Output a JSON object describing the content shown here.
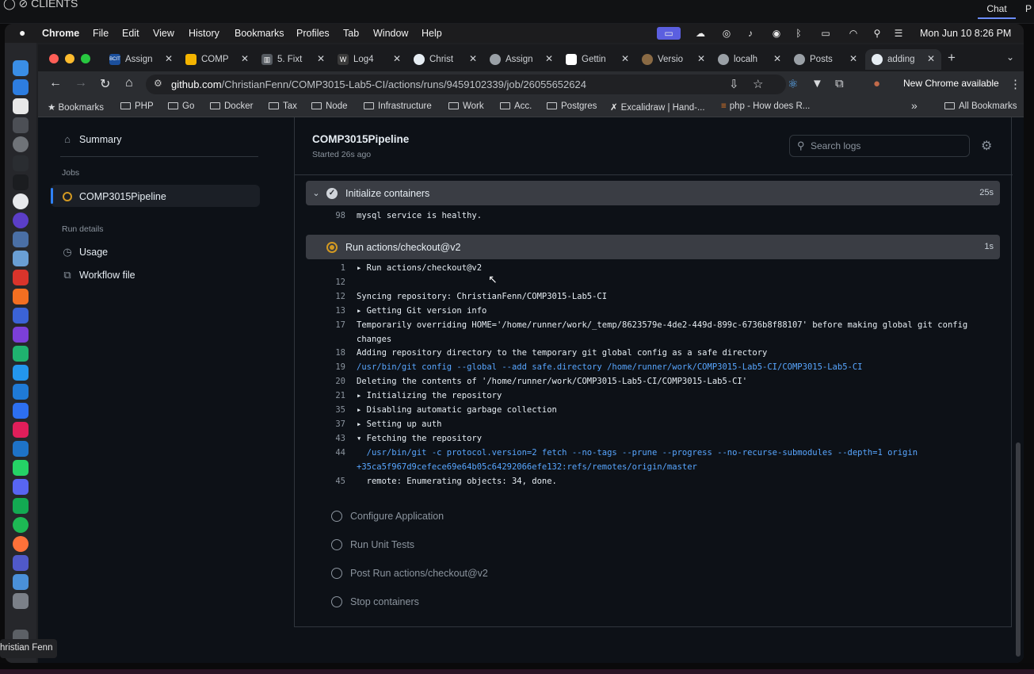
{
  "outer": {
    "top_glyphs": "◯   ⊘   CLIENTS",
    "chat_label": "Chat",
    "extra_label": "P"
  },
  "menubar": {
    "apple": "",
    "items": [
      "Chrome",
      "File",
      "Edit",
      "View",
      "History",
      "Bookmarks",
      "Profiles",
      "Tab",
      "Window",
      "Help"
    ],
    "clock": "Mon Jun 10  8:26 PM"
  },
  "tabs": [
    {
      "title": "Assign",
      "fav": "BCIT",
      "fav_color": "#1b4f9c"
    },
    {
      "title": "COMP",
      "fav": "",
      "fav_color": "#f4b400"
    },
    {
      "title": "5. Fixt",
      "fav": "▥",
      "fav_color": "#555a60"
    },
    {
      "title": "Log4",
      "fav": "W",
      "fav_color": "#3a3a3a"
    },
    {
      "title": "Christ",
      "fav": "",
      "fav_color": "#e6edf3"
    },
    {
      "title": "Assign",
      "fav": "",
      "fav_color": "#9aa0a6"
    },
    {
      "title": "Gettin",
      "fav": "",
      "fav_color": "#ffffff"
    },
    {
      "title": "Versio",
      "fav": "",
      "fav_color": "#8a6a44"
    },
    {
      "title": "localh",
      "fav": "",
      "fav_color": "#9aa0a6"
    },
    {
      "title": "Posts",
      "fav": "",
      "fav_color": "#9aa0a6"
    },
    {
      "title": "adding",
      "fav": "",
      "fav_color": "#e6edf3"
    }
  ],
  "address": {
    "host": "github.com",
    "path": "/ChristianFenn/COMP3015-Lab5-CI/actions/runs/9459102339/job/26055652624"
  },
  "toolbar": {
    "new_chrome": "New Chrome available"
  },
  "bookmarks": {
    "first": "Bookmarks",
    "items": [
      "PHP",
      "Go",
      "Docker",
      "Tax",
      "Node",
      "Infrastructure",
      "Work",
      "Acc.",
      "Postgres",
      "Excalidraw | Hand-...",
      "php - How does R..."
    ],
    "overflow": "»",
    "all": "All Bookmarks"
  },
  "sidebar": {
    "summary": "Summary",
    "jobs_heading": "Jobs",
    "job": "COMP3015Pipeline",
    "run_details_heading": "Run details",
    "usage": "Usage",
    "workflow_file": "Workflow file"
  },
  "job": {
    "title": "COMP3015Pipeline",
    "started": "Started 26s ago",
    "search_placeholder": "Search logs"
  },
  "steps": {
    "initialize": {
      "name": "Initialize containers",
      "duration": "25s"
    },
    "checkout": {
      "name": "Run actions/checkout@v2",
      "duration": "1s"
    },
    "pending": [
      "Configure Application",
      "Run Unit Tests",
      "Post Run actions/checkout@v2",
      "Stop containers"
    ]
  },
  "log_top": {
    "n": "98",
    "text": "mysql service is healthy."
  },
  "log": [
    {
      "n": "1",
      "text": "▸ Run actions/checkout@v2",
      "cmd": false
    },
    {
      "n": "12",
      "text": "",
      "cmd": false
    },
    {
      "n": "12",
      "text": "Syncing repository: ChristianFenn/COMP3015-Lab5-CI",
      "cmd": false
    },
    {
      "n": "13",
      "text": "▸ Getting Git version info",
      "cmd": false
    },
    {
      "n": "17",
      "text": "Temporarily overriding HOME='/home/runner/work/_temp/8623579e-4de2-449d-899c-6736b8f88107' before making global git config",
      "cmd": false
    },
    {
      "n": "",
      "text": "changes",
      "cmd": false
    },
    {
      "n": "18",
      "text": "Adding repository directory to the temporary git global config as a safe directory",
      "cmd": false
    },
    {
      "n": "19",
      "text": "/usr/bin/git config --global --add safe.directory /home/runner/work/COMP3015-Lab5-CI/COMP3015-Lab5-CI",
      "cmd": true
    },
    {
      "n": "20",
      "text": "Deleting the contents of '/home/runner/work/COMP3015-Lab5-CI/COMP3015-Lab5-CI'",
      "cmd": false
    },
    {
      "n": "21",
      "text": "▸ Initializing the repository",
      "cmd": false
    },
    {
      "n": "35",
      "text": "▸ Disabling automatic garbage collection",
      "cmd": false
    },
    {
      "n": "37",
      "text": "▸ Setting up auth",
      "cmd": false
    },
    {
      "n": "43",
      "text": "▾ Fetching the repository",
      "cmd": false
    },
    {
      "n": "44",
      "text": "  /usr/bin/git -c protocol.version=2 fetch --no-tags --prune --progress --no-recurse-submodules --depth=1 origin",
      "cmd": true
    },
    {
      "n": "",
      "text": "+35ca5f967d9cefece69e64b05c64292066efe132:refs/remotes/origin/master",
      "cmd": true
    },
    {
      "n": "45",
      "text": "  remote: Enumerating objects: 34, done.",
      "cmd": false
    }
  ],
  "tooltip": "hristian Fenn",
  "colors": {
    "accent": "#2f81f7",
    "running": "#d29922",
    "command": "#58a6ff",
    "bg": "#0d1117"
  }
}
